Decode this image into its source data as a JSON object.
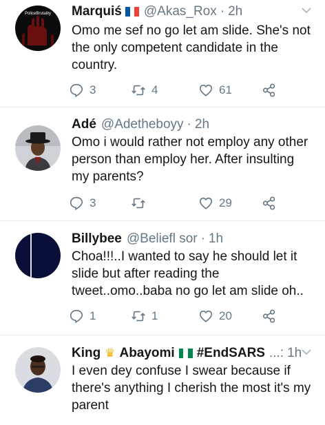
{
  "tweets": [
    {
      "name": "Marquiś",
      "flag": "france",
      "handle": "@Akas_Rox",
      "dot": "·",
      "time": "2h",
      "text": "Omo me sef no go let am slide. She's not the only competent candidate in the country.",
      "replies": "3",
      "retweets": "4",
      "likes": "61",
      "avatar_label": "PoliceBrutality"
    },
    {
      "name": "Adé",
      "handle": "@Adetheboyy",
      "dot": "·",
      "time": "2h",
      "text": "Omo i would rather not employ any other person than employ her. After insulting my parents?",
      "replies": "3",
      "retweets": "",
      "likes": "29"
    },
    {
      "name": "Billybee",
      "handle": "@Beliefl sor",
      "dot": "·",
      "time": "1h",
      "text": "Choa!!!..I wanted to say he should let it slide but after reading the tweet..omo..baba no go let am slide oh..",
      "replies": "1",
      "retweets": "1",
      "likes": "20"
    },
    {
      "name": "King",
      "name2": "Abayomi",
      "tag": "#EndSARS",
      "ellipsis": "...:",
      "time": "1h",
      "text": "I even dey confuse I swear because if there's anything I cherish the most it's my parent"
    }
  ],
  "colors": {
    "text": "#14171a",
    "secondary": "#657786",
    "divider": "#e6ecf0",
    "nigeria_green": "#008751",
    "france_blue": "#0055a4",
    "france_red": "#ef4135"
  },
  "icons": [
    "reply-icon",
    "retweet-icon",
    "like-icon",
    "share-icon",
    "chevron-down-icon",
    "crown-emoji",
    "nigeria-flag",
    "france-flag"
  ]
}
